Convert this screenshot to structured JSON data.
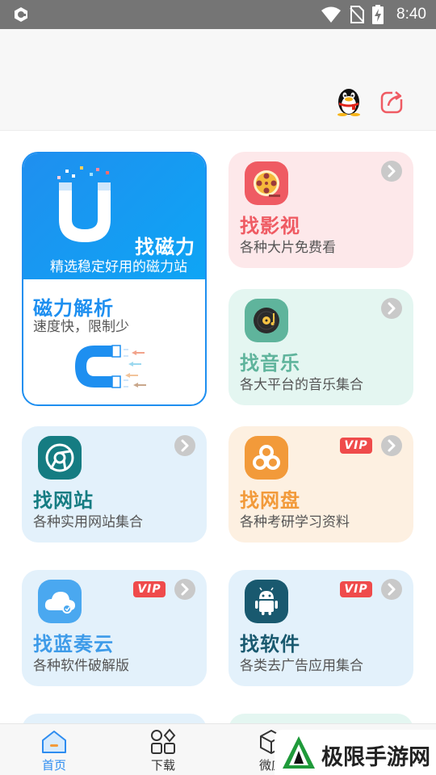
{
  "status_bar": {
    "time": "8:40"
  },
  "colors": {
    "accent": "#1e8ff0",
    "vip": "#ef4b4b"
  },
  "magnet_card": {
    "title": "找磁力",
    "description": "精选稳定好用的磁力站",
    "parse_title": "磁力解析",
    "parse_desc": "速度快，限制少"
  },
  "cards": [
    {
      "title": "找影视",
      "desc": "各种大片免费看",
      "icon": "film-reel-icon",
      "bg": "#fde8ea",
      "title_color": "#ef5b63"
    },
    {
      "title": "找音乐",
      "desc": "各大平台的音乐集合",
      "icon": "vinyl-record-icon",
      "bg": "#e4f6f1",
      "title_color": "#5fb49c"
    },
    {
      "title": "找网站",
      "desc": "各种实用网站集合",
      "icon": "browser-icon",
      "bg": "#e3f1fb",
      "title_color": "#157c82"
    },
    {
      "title": "找网盘",
      "desc": "各种考研学习资料",
      "icon": "cloud-disk-icon",
      "bg": "#fdf0e1",
      "title_color": "#f29a3a",
      "vip": "VIP"
    },
    {
      "title": "找蓝奏云",
      "desc": "各种软件破解版",
      "icon": "cloud-icon",
      "bg": "#e3f1fb",
      "title_color": "#3d9be9",
      "vip": "VIP"
    },
    {
      "title": "找软件",
      "desc": "各类去广告应用集合",
      "icon": "android-icon",
      "bg": "#e3f1fb",
      "title_color": "#19596f",
      "vip": "VIP"
    }
  ],
  "bottom_nav": [
    {
      "label": "首页",
      "icon": "home-icon",
      "active": true
    },
    {
      "label": "下载",
      "icon": "grid-icon"
    },
    {
      "label": "微应",
      "icon": "box-icon"
    }
  ],
  "watermark": "极限手游网"
}
